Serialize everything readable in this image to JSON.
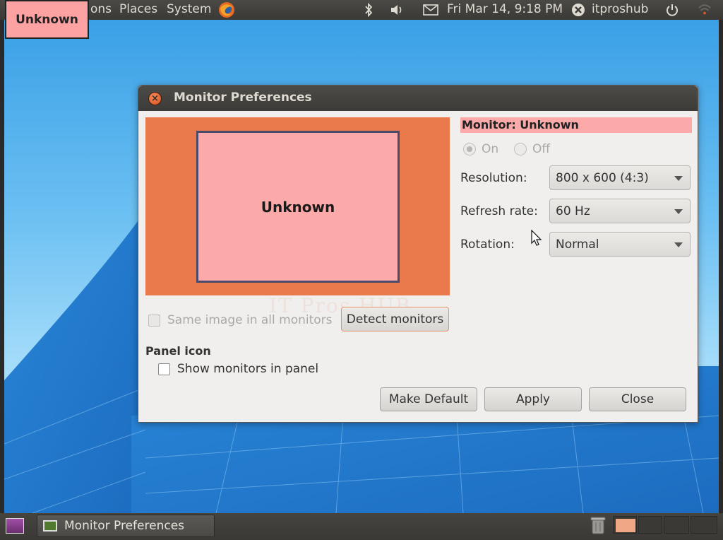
{
  "top_panel": {
    "badge": "Unknown",
    "menus": [
      "ons",
      "Places",
      "System"
    ],
    "clock": "Fri Mar 14,  9:18 PM",
    "user": "itproshub"
  },
  "dialog": {
    "title": "Monitor Preferences",
    "monitor_preview_label": "Unknown",
    "watermark": "IT Pros HUB",
    "monitor_name": "Monitor: Unknown",
    "radio_on": "On",
    "radio_off": "Off",
    "resolution_label": "Resolution:",
    "resolution_value": "800 x 600 (4:3)",
    "refresh_label": "Refresh rate:",
    "refresh_value": "60 Hz",
    "rotation_label": "Rotation:",
    "rotation_value": "Normal",
    "same_image_label": "Same image in all monitors",
    "detect_button": "Detect monitors",
    "panel_icon_heading": "Panel icon",
    "show_monitors_label": "Show monitors in panel",
    "make_default_button": "Make Default",
    "apply_button": "Apply",
    "close_button": "Close"
  },
  "bottom_panel": {
    "task_label": "Monitor Preferences"
  },
  "colors": {
    "accent": "#ea7a4b",
    "monitor_fill": "#fca9a9",
    "panel": "#3c3b37"
  }
}
